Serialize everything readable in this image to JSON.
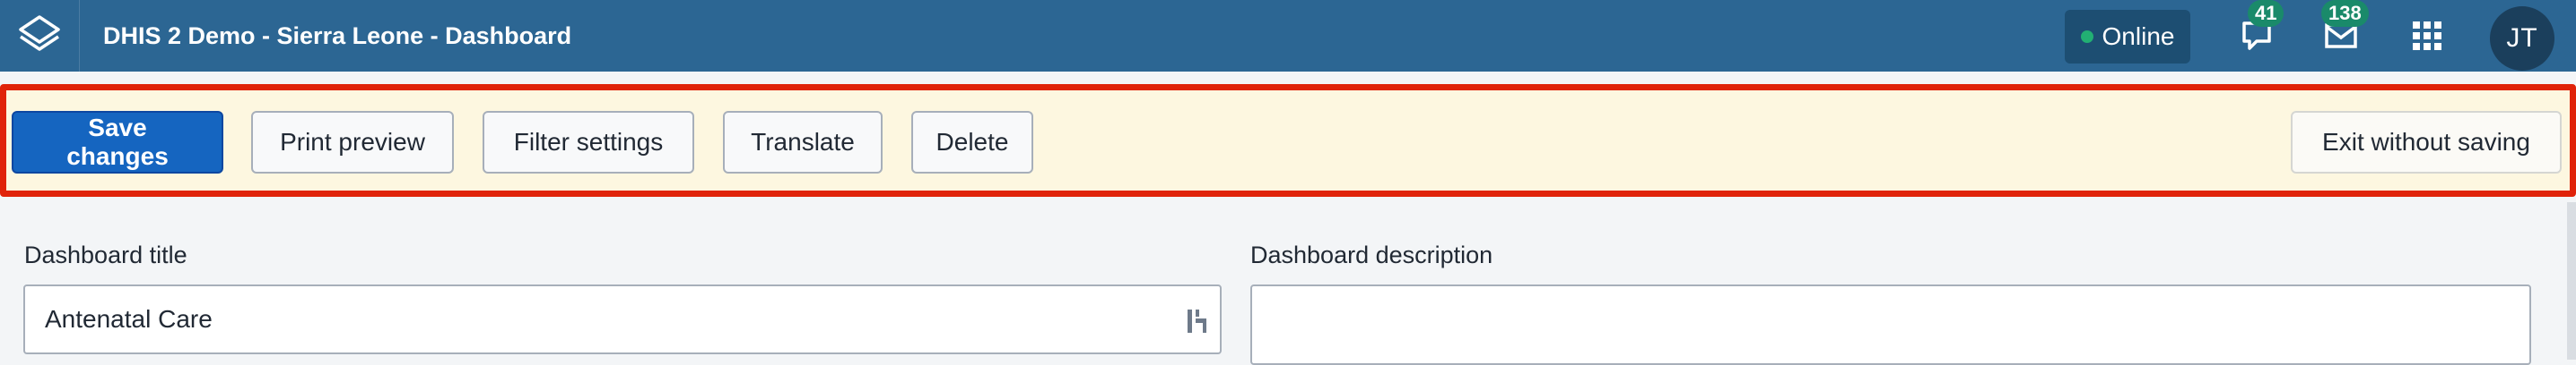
{
  "header": {
    "title": "DHIS 2 Demo - Sierra Leone - Dashboard",
    "online_label": "Online",
    "interpretations_count": "41",
    "messages_count": "138",
    "avatar_initials": "JT",
    "colors": {
      "bar": "#2c6693",
      "online_dot": "#22b073",
      "badge": "#1a8a6a"
    }
  },
  "toolbar": {
    "save_label": "Save changes",
    "print_preview_label": "Print preview",
    "filter_settings_label": "Filter settings",
    "translate_label": "Translate",
    "delete_label": "Delete",
    "exit_label": "Exit without saving",
    "colors": {
      "highlight_border": "#e0230a",
      "background": "#fdf7e0",
      "primary": "#1565c0"
    }
  },
  "form": {
    "title_label": "Dashboard title",
    "title_value": "Antenatal Care",
    "description_label": "Dashboard description",
    "description_value": ""
  }
}
